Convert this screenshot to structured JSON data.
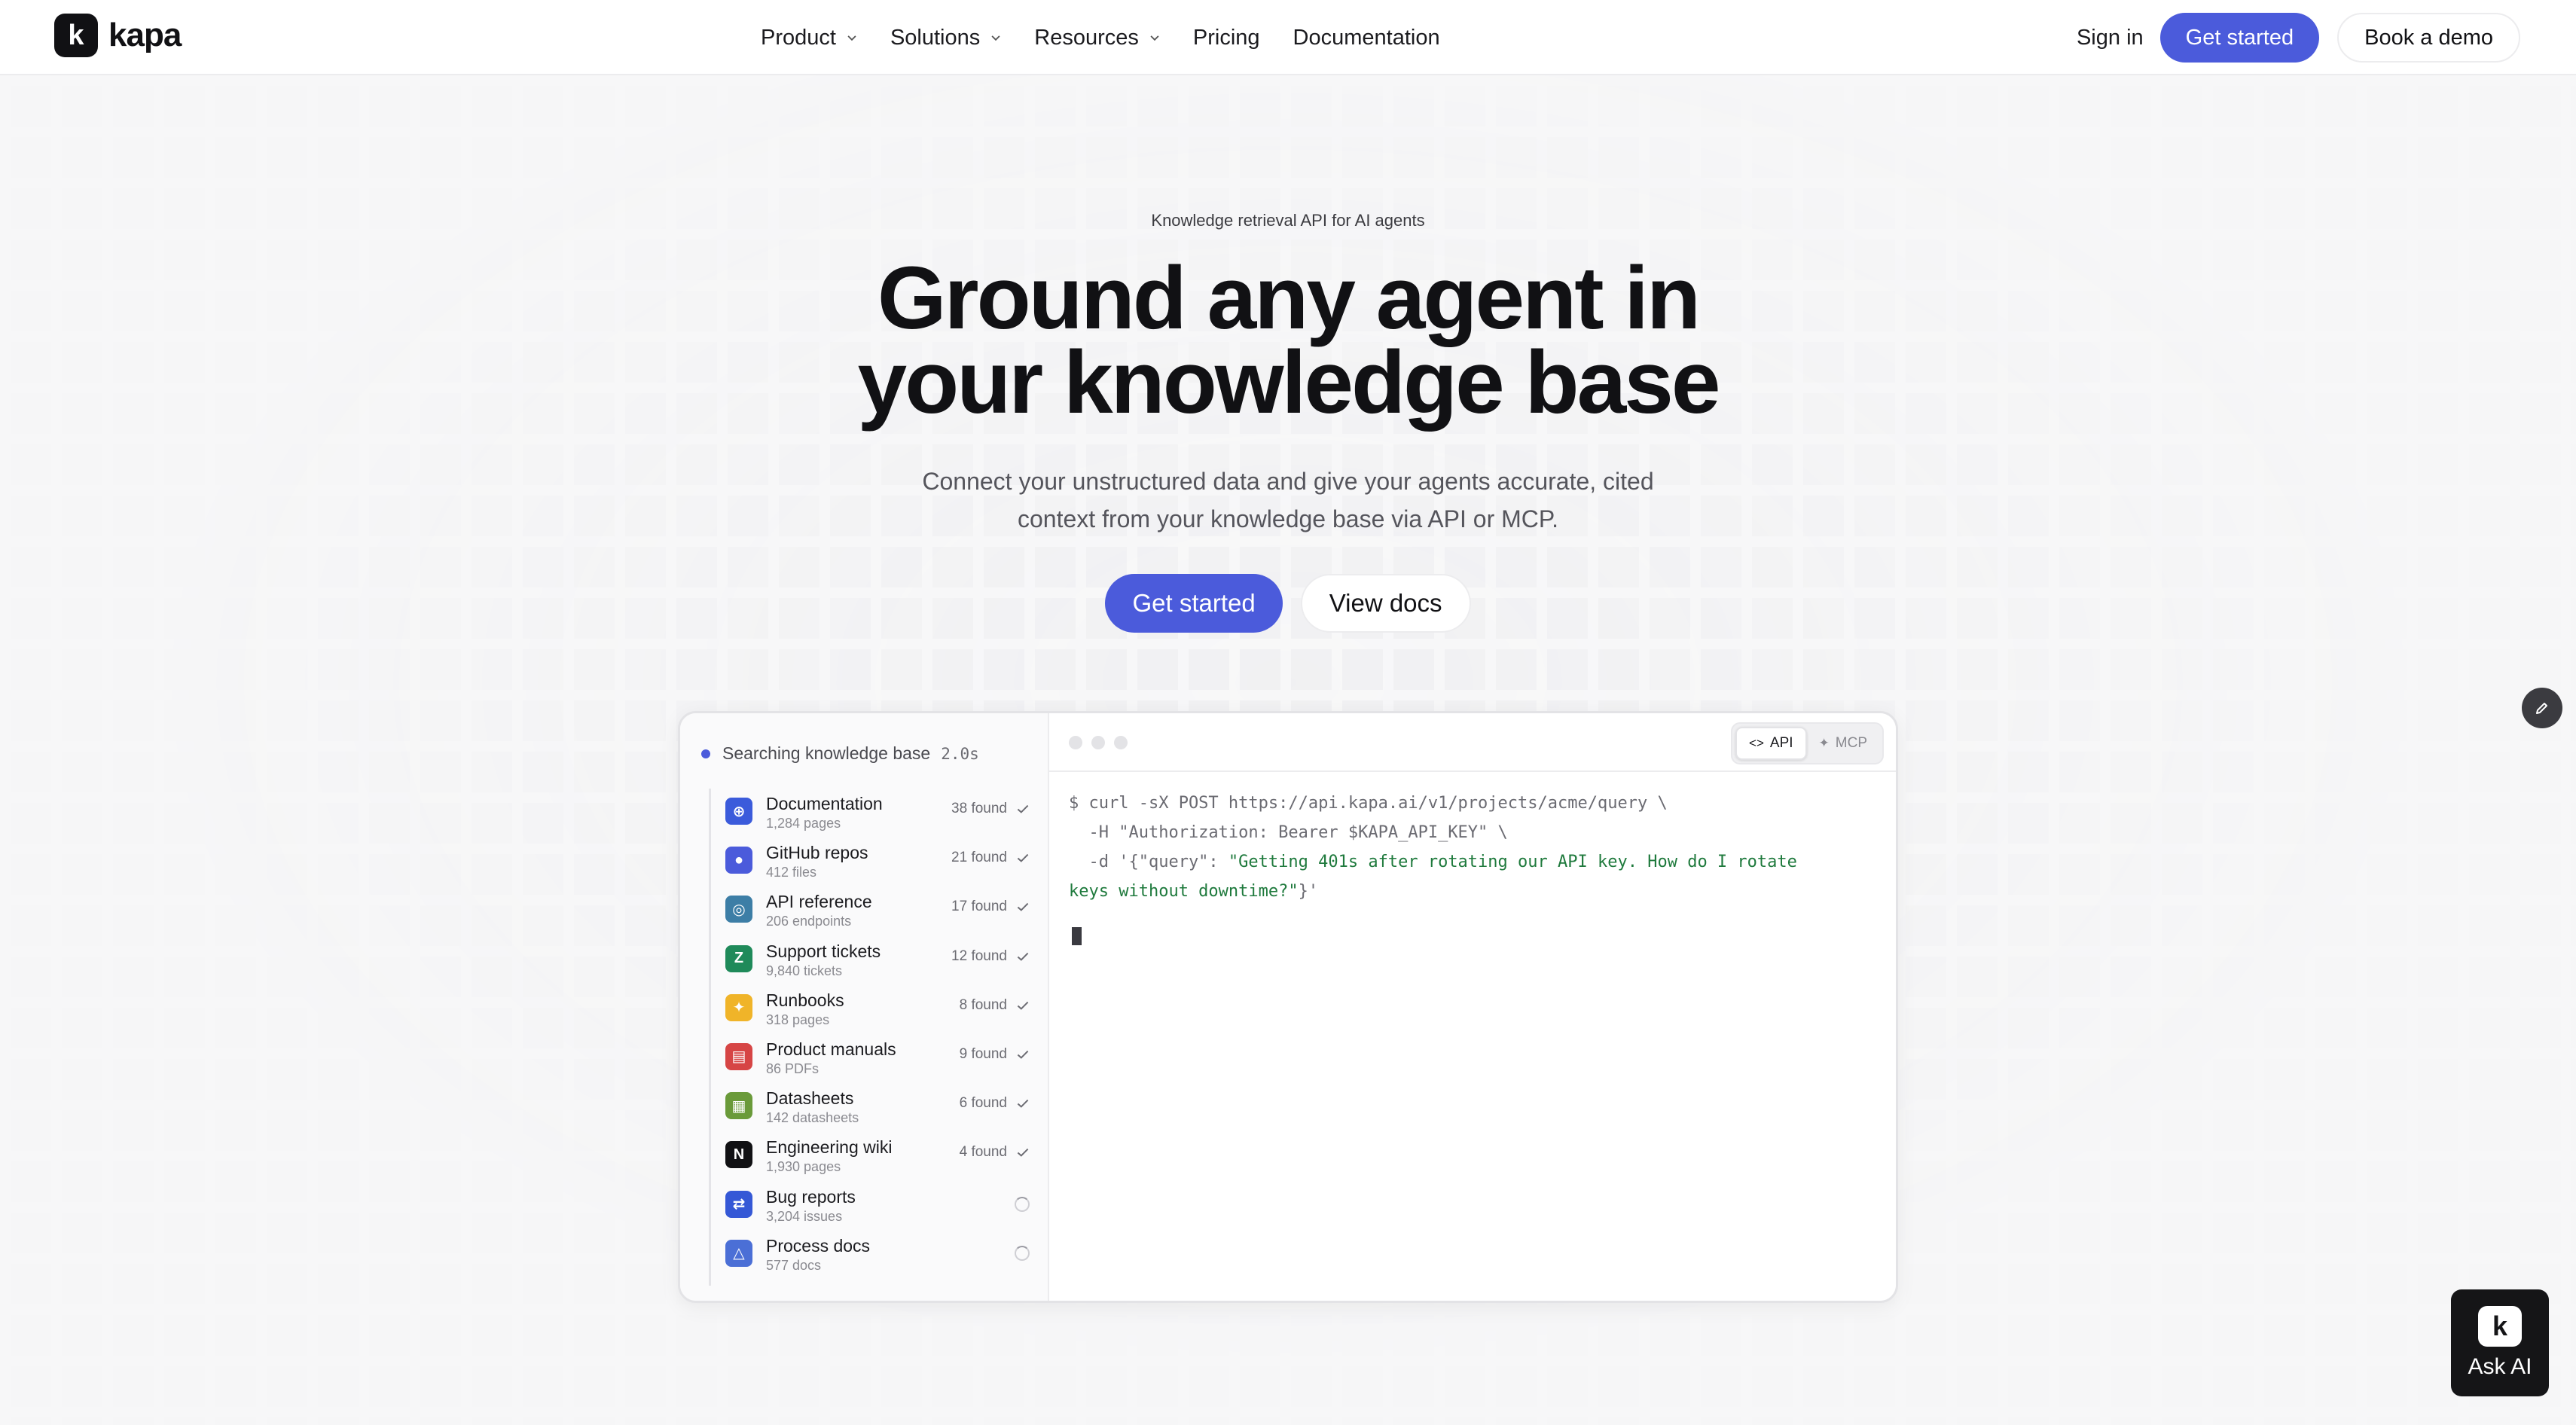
{
  "brand": {
    "name": "kapa",
    "mark": "k"
  },
  "nav": {
    "items": [
      {
        "label": "Product",
        "has_menu": true
      },
      {
        "label": "Solutions",
        "has_menu": true
      },
      {
        "label": "Resources",
        "has_menu": true
      },
      {
        "label": "Pricing",
        "has_menu": false
      },
      {
        "label": "Documentation",
        "has_menu": false
      }
    ],
    "sign_in": "Sign in",
    "get_started": "Get started",
    "book_demo": "Book a demo"
  },
  "hero": {
    "eyebrow": "Knowledge retrieval API for AI agents",
    "headline_line1": "Ground any agent in",
    "headline_line2": "your knowledge base",
    "subhead_line1": "Connect your unstructured data and give your agents accurate, cited",
    "subhead_line2": "context from your knowledge base via API or MCP.",
    "cta_primary": "Get started",
    "cta_secondary": "View docs"
  },
  "demo": {
    "status": {
      "label": "Searching knowledge base",
      "elapsed": "2.0s"
    },
    "sources": [
      {
        "name": "Documentation",
        "count": "1,284 pages",
        "found": "38 found",
        "state": "done",
        "icon": "globe-icon",
        "color": "#3b5bdb"
      },
      {
        "name": "GitHub repos",
        "count": "412 files",
        "found": "21 found",
        "state": "done",
        "icon": "github-icon",
        "color": "#4b5bdb"
      },
      {
        "name": "API reference",
        "count": "206 endpoints",
        "found": "17 found",
        "state": "done",
        "icon": "api-icon",
        "color": "#3d7ea6"
      },
      {
        "name": "Support tickets",
        "count": "9,840 tickets",
        "found": "12 found",
        "state": "done",
        "icon": "zendesk-icon",
        "color": "#1f8a5a"
      },
      {
        "name": "Runbooks",
        "count": "318 pages",
        "found": "8 found",
        "state": "done",
        "icon": "runbook-icon",
        "color": "#f0b429"
      },
      {
        "name": "Product manuals",
        "count": "86 PDFs",
        "found": "9 found",
        "state": "done",
        "icon": "pdf-icon",
        "color": "#d64545"
      },
      {
        "name": "Datasheets",
        "count": "142 datasheets",
        "found": "6 found",
        "state": "done",
        "icon": "sheet-icon",
        "color": "#6a9a3a"
      },
      {
        "name": "Engineering wiki",
        "count": "1,930 pages",
        "found": "4 found",
        "state": "done",
        "icon": "notion-icon",
        "color": "#111114"
      },
      {
        "name": "Bug reports",
        "count": "3,204 issues",
        "found": "",
        "state": "loading",
        "icon": "jira-icon",
        "color": "#3558d6"
      },
      {
        "name": "Process docs",
        "count": "577 docs",
        "found": "",
        "state": "loading",
        "icon": "confluence-icon",
        "color": "#4b6fd6"
      }
    ],
    "tabs": [
      {
        "label": "API",
        "icon": "code-icon",
        "active": true
      },
      {
        "label": "MCP",
        "icon": "mcp-icon",
        "active": false
      }
    ],
    "code": {
      "line1": "$ curl -sX POST https://api.kapa.ai/v1/projects/acme/query \\",
      "line2": "  -H \"Authorization: Bearer $KAPA_API_KEY\" \\",
      "line3_prefix": "  -d '{\"query\": ",
      "line3_str": "\"Getting 401s after rotating our API key. How do I rotate",
      "line4_str": "keys without downtime?\"",
      "line4_suffix": "}'"
    }
  },
  "widgets": {
    "ask_ai": "Ask AI",
    "ask_ai_mark": "k"
  },
  "colors": {
    "accent": "#4b5bdb",
    "text": "#111114",
    "muted": "#55555c"
  }
}
